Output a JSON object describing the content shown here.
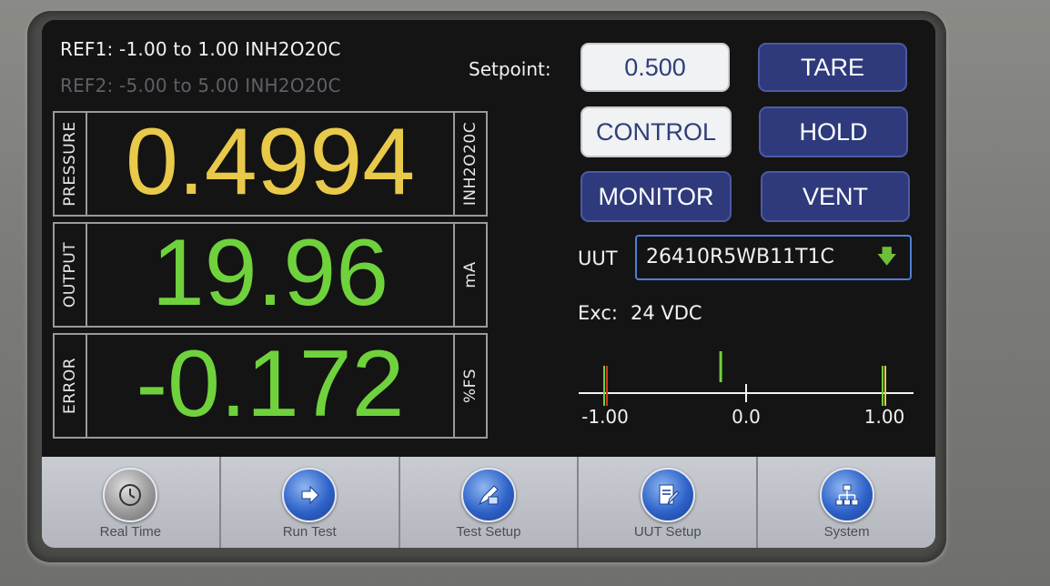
{
  "header": {
    "ref1": "REF1: -1.00 to 1.00 INH2O20C",
    "ref2": "REF2: -5.00 to 5.00 INH2O20C"
  },
  "measurements": [
    {
      "label": "PRESSURE",
      "value": "0.4994",
      "unit": "INH2O20C",
      "color": "#e8c94a"
    },
    {
      "label": "OUTPUT",
      "value": "19.96",
      "unit": "mA",
      "color": "#6fd23c"
    },
    {
      "label": "ERROR",
      "value": "-0.172",
      "unit": "%FS",
      "color": "#6fd23c"
    }
  ],
  "controls": {
    "setpoint_label": "Setpoint:",
    "setpoint_value": "0.500",
    "tare": "TARE",
    "control": "CONTROL",
    "hold": "HOLD",
    "monitor": "MONITOR",
    "vent": "VENT"
  },
  "uut": {
    "label": "UUT",
    "value": "26410R5WB11T1C",
    "icon": "green-down-arrow-icon"
  },
  "excitation": {
    "label": "Exc:",
    "value": "24 VDC"
  },
  "scale": {
    "ticks": [
      "-1.00",
      "0.0",
      "1.00"
    ],
    "min": -1.0,
    "max": 1.0,
    "marker_value": -0.172
  },
  "nav": [
    {
      "label": "Real Time",
      "icon": "clock-icon"
    },
    {
      "label": "Run Test",
      "icon": "play-arrow-icon"
    },
    {
      "label": "Test Setup",
      "icon": "edit-setup-icon"
    },
    {
      "label": "UUT Setup",
      "icon": "document-edit-icon"
    },
    {
      "label": "System",
      "icon": "network-icon"
    }
  ],
  "colors": {
    "button_blue": "#2e3a7c",
    "button_light": "#f1f2f4",
    "pressure": "#e8c94a",
    "output": "#6fd23c"
  }
}
